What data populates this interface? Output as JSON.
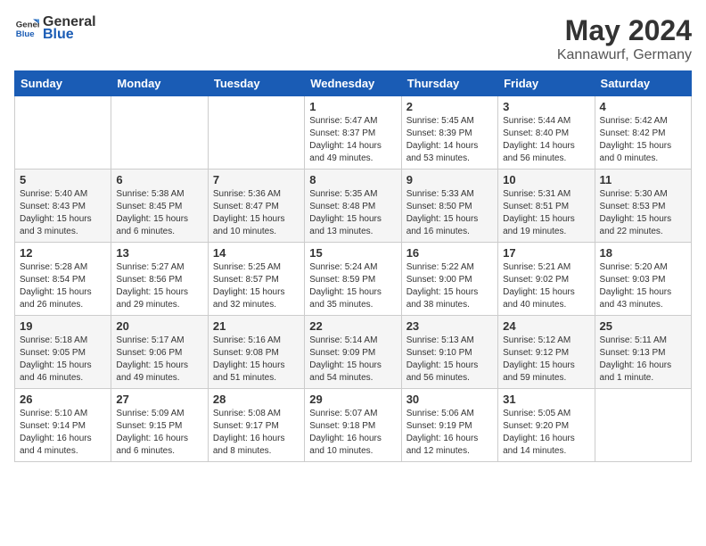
{
  "header": {
    "logo_general": "General",
    "logo_blue": "Blue",
    "month_year": "May 2024",
    "location": "Kannawurf, Germany"
  },
  "weekdays": [
    "Sunday",
    "Monday",
    "Tuesday",
    "Wednesday",
    "Thursday",
    "Friday",
    "Saturday"
  ],
  "weeks": [
    [
      {
        "day": "",
        "info": ""
      },
      {
        "day": "",
        "info": ""
      },
      {
        "day": "",
        "info": ""
      },
      {
        "day": "1",
        "info": "Sunrise: 5:47 AM\nSunset: 8:37 PM\nDaylight: 14 hours\nand 49 minutes."
      },
      {
        "day": "2",
        "info": "Sunrise: 5:45 AM\nSunset: 8:39 PM\nDaylight: 14 hours\nand 53 minutes."
      },
      {
        "day": "3",
        "info": "Sunrise: 5:44 AM\nSunset: 8:40 PM\nDaylight: 14 hours\nand 56 minutes."
      },
      {
        "day": "4",
        "info": "Sunrise: 5:42 AM\nSunset: 8:42 PM\nDaylight: 15 hours\nand 0 minutes."
      }
    ],
    [
      {
        "day": "5",
        "info": "Sunrise: 5:40 AM\nSunset: 8:43 PM\nDaylight: 15 hours\nand 3 minutes."
      },
      {
        "day": "6",
        "info": "Sunrise: 5:38 AM\nSunset: 8:45 PM\nDaylight: 15 hours\nand 6 minutes."
      },
      {
        "day": "7",
        "info": "Sunrise: 5:36 AM\nSunset: 8:47 PM\nDaylight: 15 hours\nand 10 minutes."
      },
      {
        "day": "8",
        "info": "Sunrise: 5:35 AM\nSunset: 8:48 PM\nDaylight: 15 hours\nand 13 minutes."
      },
      {
        "day": "9",
        "info": "Sunrise: 5:33 AM\nSunset: 8:50 PM\nDaylight: 15 hours\nand 16 minutes."
      },
      {
        "day": "10",
        "info": "Sunrise: 5:31 AM\nSunset: 8:51 PM\nDaylight: 15 hours\nand 19 minutes."
      },
      {
        "day": "11",
        "info": "Sunrise: 5:30 AM\nSunset: 8:53 PM\nDaylight: 15 hours\nand 22 minutes."
      }
    ],
    [
      {
        "day": "12",
        "info": "Sunrise: 5:28 AM\nSunset: 8:54 PM\nDaylight: 15 hours\nand 26 minutes."
      },
      {
        "day": "13",
        "info": "Sunrise: 5:27 AM\nSunset: 8:56 PM\nDaylight: 15 hours\nand 29 minutes."
      },
      {
        "day": "14",
        "info": "Sunrise: 5:25 AM\nSunset: 8:57 PM\nDaylight: 15 hours\nand 32 minutes."
      },
      {
        "day": "15",
        "info": "Sunrise: 5:24 AM\nSunset: 8:59 PM\nDaylight: 15 hours\nand 35 minutes."
      },
      {
        "day": "16",
        "info": "Sunrise: 5:22 AM\nSunset: 9:00 PM\nDaylight: 15 hours\nand 38 minutes."
      },
      {
        "day": "17",
        "info": "Sunrise: 5:21 AM\nSunset: 9:02 PM\nDaylight: 15 hours\nand 40 minutes."
      },
      {
        "day": "18",
        "info": "Sunrise: 5:20 AM\nSunset: 9:03 PM\nDaylight: 15 hours\nand 43 minutes."
      }
    ],
    [
      {
        "day": "19",
        "info": "Sunrise: 5:18 AM\nSunset: 9:05 PM\nDaylight: 15 hours\nand 46 minutes."
      },
      {
        "day": "20",
        "info": "Sunrise: 5:17 AM\nSunset: 9:06 PM\nDaylight: 15 hours\nand 49 minutes."
      },
      {
        "day": "21",
        "info": "Sunrise: 5:16 AM\nSunset: 9:08 PM\nDaylight: 15 hours\nand 51 minutes."
      },
      {
        "day": "22",
        "info": "Sunrise: 5:14 AM\nSunset: 9:09 PM\nDaylight: 15 hours\nand 54 minutes."
      },
      {
        "day": "23",
        "info": "Sunrise: 5:13 AM\nSunset: 9:10 PM\nDaylight: 15 hours\nand 56 minutes."
      },
      {
        "day": "24",
        "info": "Sunrise: 5:12 AM\nSunset: 9:12 PM\nDaylight: 15 hours\nand 59 minutes."
      },
      {
        "day": "25",
        "info": "Sunrise: 5:11 AM\nSunset: 9:13 PM\nDaylight: 16 hours\nand 1 minute."
      }
    ],
    [
      {
        "day": "26",
        "info": "Sunrise: 5:10 AM\nSunset: 9:14 PM\nDaylight: 16 hours\nand 4 minutes."
      },
      {
        "day": "27",
        "info": "Sunrise: 5:09 AM\nSunset: 9:15 PM\nDaylight: 16 hours\nand 6 minutes."
      },
      {
        "day": "28",
        "info": "Sunrise: 5:08 AM\nSunset: 9:17 PM\nDaylight: 16 hours\nand 8 minutes."
      },
      {
        "day": "29",
        "info": "Sunrise: 5:07 AM\nSunset: 9:18 PM\nDaylight: 16 hours\nand 10 minutes."
      },
      {
        "day": "30",
        "info": "Sunrise: 5:06 AM\nSunset: 9:19 PM\nDaylight: 16 hours\nand 12 minutes."
      },
      {
        "day": "31",
        "info": "Sunrise: 5:05 AM\nSunset: 9:20 PM\nDaylight: 16 hours\nand 14 minutes."
      },
      {
        "day": "",
        "info": ""
      }
    ]
  ]
}
